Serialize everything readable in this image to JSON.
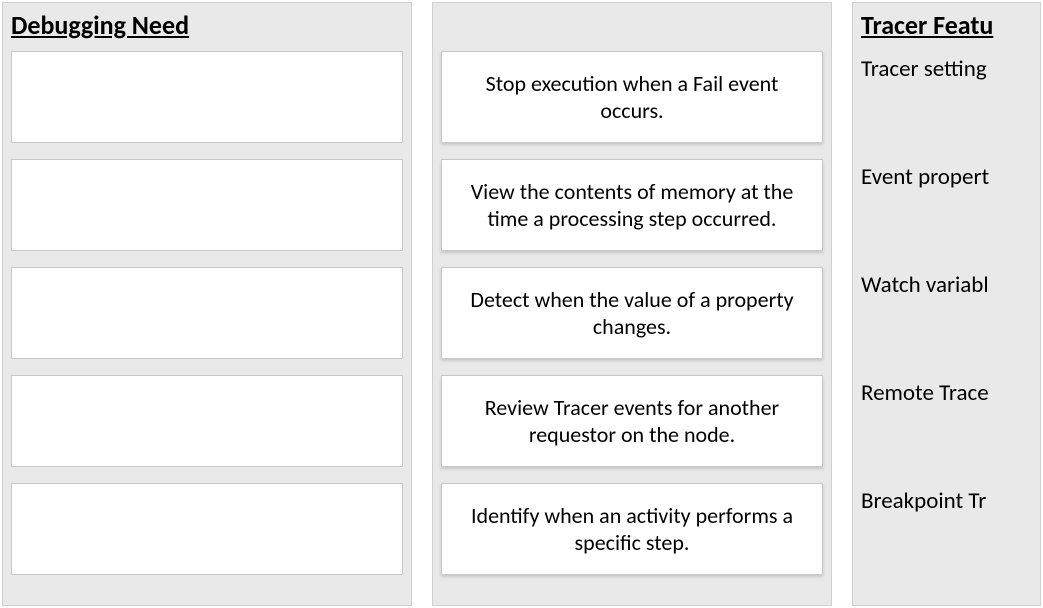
{
  "left": {
    "header": "Debugging Need",
    "slots": [
      "",
      "",
      "",
      "",
      ""
    ]
  },
  "middle": {
    "cards": [
      "Stop execution when a Fail event occurs.",
      "View the contents of memory at the time a  processing step occurred.",
      "Detect when the value of a property changes.",
      "Review Tracer events for another requestor on the node.",
      "Identify when an activity performs a specific step."
    ]
  },
  "right": {
    "header": "Tracer Featu",
    "features": [
      "Tracer setting",
      "Event propert",
      "Watch variabl",
      "Remote Trace",
      "Breakpoint Tr"
    ]
  }
}
